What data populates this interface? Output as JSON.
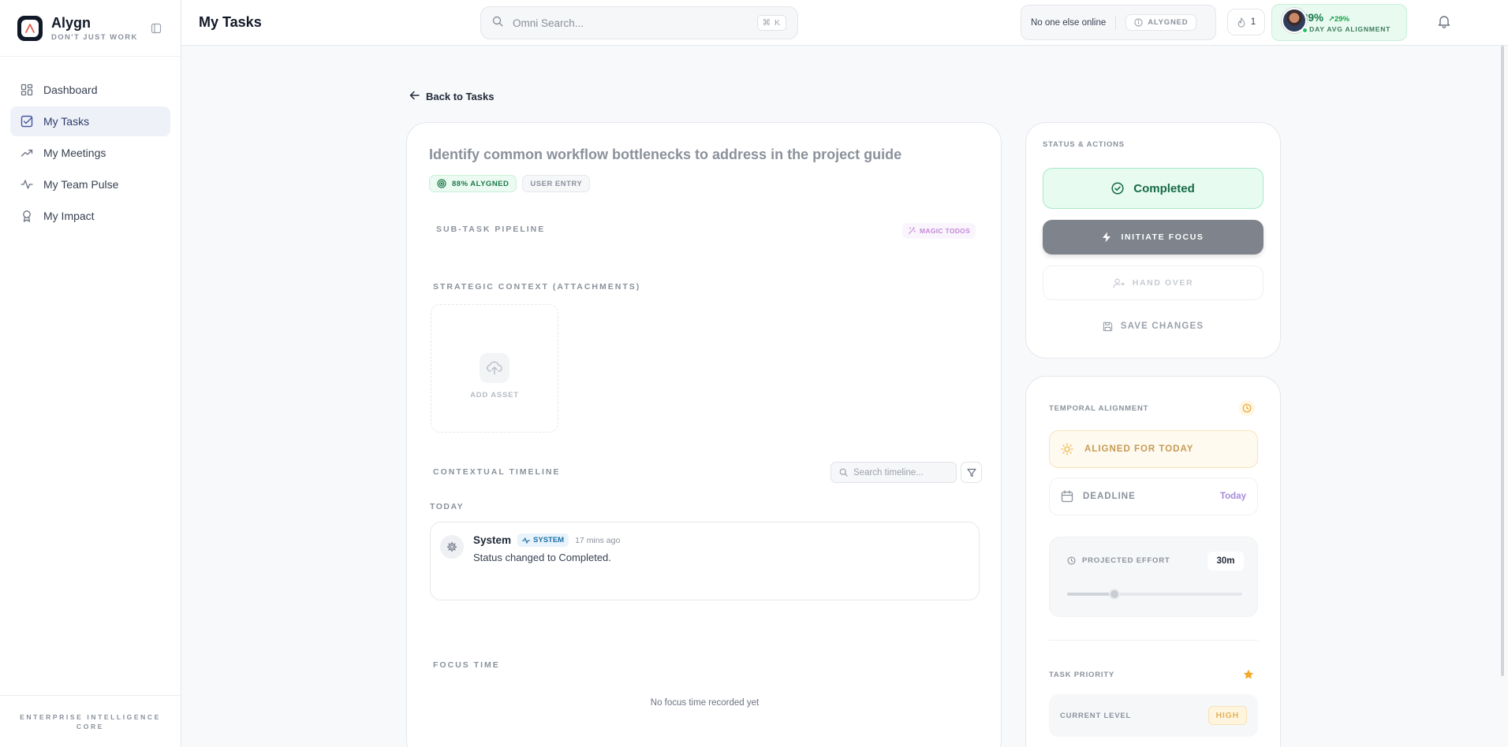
{
  "app": {
    "name": "Alygn",
    "tagline": "DON'T JUST WORK"
  },
  "sidebar": {
    "items": [
      {
        "label": "Dashboard",
        "icon": "dashboard-icon",
        "active": false
      },
      {
        "label": "My Tasks",
        "icon": "task-check-icon",
        "active": true
      },
      {
        "label": "My Meetings",
        "icon": "trend-icon",
        "active": false
      },
      {
        "label": "My Team Pulse",
        "icon": "pulse-icon",
        "active": false
      },
      {
        "label": "My Impact",
        "icon": "award-icon",
        "active": false
      }
    ],
    "footer_line1": "ENTERPRISE INTELLIGENCE",
    "footer_line2": "CORE"
  },
  "header": {
    "title": "My Tasks",
    "search_placeholder": "Omni Search...",
    "search_shortcut": "⌘ K",
    "presence_text": "No one else online",
    "presence_badge": "ALYGNED",
    "streak_count": "1",
    "alignment_pct": "89%",
    "alignment_delta": "↗29%",
    "alignment_label": "7-DAY AVG ALIGNMENT"
  },
  "task": {
    "back_label": "Back to Tasks",
    "title": "Identify common workflow bottlenecks to address in the project guide",
    "aligned_chip": "88% ALYGNED",
    "source_chip": "USER ENTRY",
    "subtask_label": "SUB-TASK PIPELINE",
    "magic_label": "MAGIC TODOS",
    "attachments_label": "STRATEGIC CONTEXT (ATTACHMENTS)",
    "add_asset_label": "ADD ASSET",
    "timeline_label": "CONTEXTUAL TIMELINE",
    "timeline_search_placeholder": "Search timeline...",
    "timeline_day": "TODAY",
    "timeline_entries": [
      {
        "author": "System",
        "badge": "SYSTEM",
        "time": "17 mins ago",
        "message": "Status changed to Completed."
      }
    ],
    "focus_label": "FOCUS TIME",
    "focus_empty": "No focus time recorded yet"
  },
  "status_actions": {
    "label": "STATUS & ACTIONS",
    "status": "Completed",
    "initiate_focus": "INITIATE FOCUS",
    "hand_over": "HAND OVER",
    "save_changes": "SAVE CHANGES"
  },
  "temporal": {
    "label": "TEMPORAL ALIGNMENT",
    "aligned_text": "ALIGNED FOR TODAY",
    "deadline_label": "DEADLINE",
    "deadline_value": "Today",
    "effort_label": "PROJECTED EFFORT",
    "effort_value": "30m",
    "effort_slider_fraction": 0.27,
    "priority_label": "TASK PRIORITY",
    "current_level_label": "CURRENT LEVEL",
    "current_level_value": "HIGH"
  },
  "colors": {
    "accent_green": "#16794a",
    "focus_button": "#7f838b",
    "priority_star": "#f4a928"
  }
}
